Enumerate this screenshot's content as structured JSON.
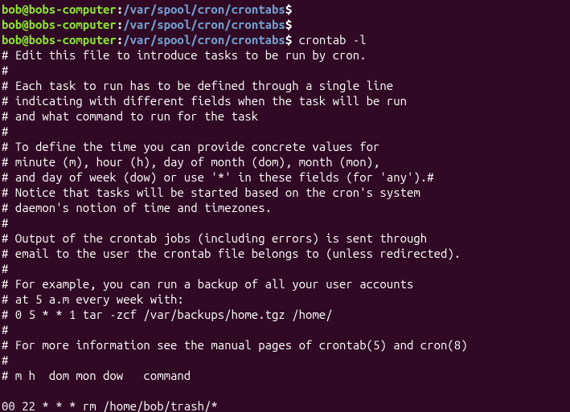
{
  "prompt": {
    "user_host": "bob@bobs-computer",
    "sep1": ":",
    "path": "/var/spool/cron/crontabs",
    "sep2": "$"
  },
  "history": [
    {
      "command": ""
    },
    {
      "command": ""
    },
    {
      "command": "crontab -l"
    }
  ],
  "output_lines": [
    "# Edit this file to introduce tasks to be run by cron.",
    "#",
    "# Each task to run has to be defined through a single line",
    "# indicating with different fields when the task will be run",
    "# and what command to run for the task",
    "#",
    "# To define the time you can provide concrete values for",
    "# minute (m), hour (h), day of month (dom), month (mon),",
    "# and day of week (dow) or use '*' in these fields (for 'any').#",
    "# Notice that tasks will be started based on the cron's system",
    "# daemon's notion of time and timezones.",
    "#",
    "# Output of the crontab jobs (including errors) is sent through",
    "# email to the user the crontab file belongs to (unless redirected).",
    "#",
    "# For example, you can run a backup of all your user accounts",
    "# at 5 a.m every week with:",
    "# 0 5 * * 1 tar -zcf /var/backups/home.tgz /home/",
    "#",
    "# For more information see the manual pages of crontab(5) and cron(8)",
    "#",
    "# m h  dom mon dow   command",
    "",
    "00 22 * * * rm /home/bob/trash/*"
  ]
}
